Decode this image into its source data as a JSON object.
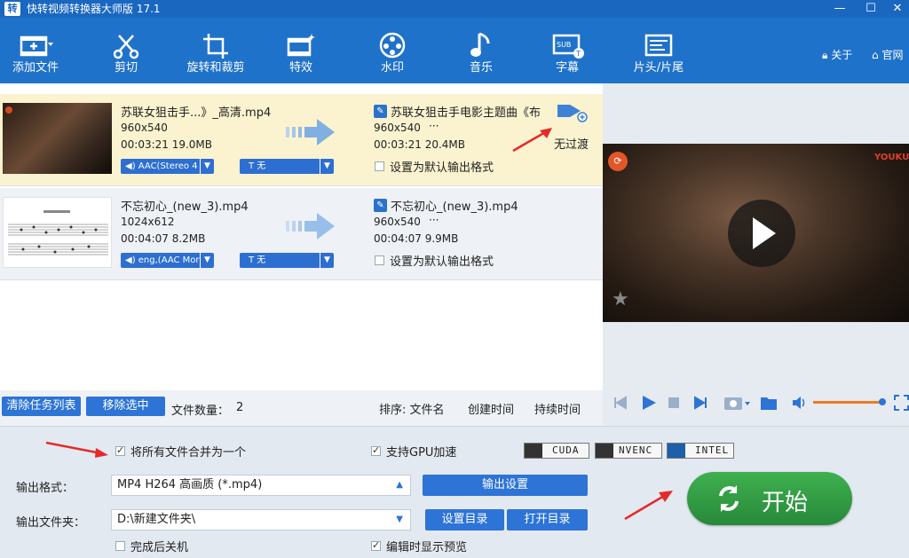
{
  "window": {
    "title": "快转视频转换器大师版 17.1",
    "logo_text": "转",
    "btn_min": "—",
    "btn_max": "☐",
    "btn_close": "✕"
  },
  "toolbar": {
    "items": [
      {
        "label": "添加文件",
        "icon": "film-add-icon"
      },
      {
        "label": "剪切",
        "icon": "scissors-icon"
      },
      {
        "label": "旋转和裁剪",
        "icon": "crop-rotate-icon"
      },
      {
        "label": "特效",
        "icon": "effects-film-icon"
      },
      {
        "label": "水印",
        "icon": "watermark-film-reel-icon"
      },
      {
        "label": "音乐",
        "icon": "music-note-icon"
      },
      {
        "label": "字幕",
        "icon": "subtitle-icon"
      },
      {
        "label": "片头/片尾",
        "icon": "intro-outro-icon"
      }
    ],
    "about": "关于",
    "website": "官网"
  },
  "tasks": [
    {
      "src_name": "苏联女狙击手...》_高清.mp4",
      "src_res": "960x540",
      "src_meta": "00:03:21  19.0MB",
      "out_name": "苏联女狙击手电影主题曲《布",
      "out_res": "960x540",
      "out_more": "···",
      "out_meta": "00:03:21  20.4MB",
      "audio": "AAC(Stereo 4",
      "subtitle": "T 无",
      "default_fmt": "设置为默认输出格式",
      "transition": "无过渡",
      "selected": true
    },
    {
      "src_name": "不忘初心_(new_3).mp4",
      "src_res": "1024x612",
      "src_meta": "00:04:07  8.2MB",
      "out_name": "不忘初心_(new_3).mp4",
      "out_res": "960x540",
      "out_more": "···",
      "out_meta": "00:04:07  9.9MB",
      "audio": "eng,(AAC Mor",
      "subtitle": "T 无",
      "default_fmt": "设置为默认输出格式",
      "selected": false
    }
  ],
  "list_footer": {
    "clear": "清除任务列表",
    "remove": "移除选中",
    "count_label": "文件数量：",
    "count": "2",
    "sort_label": "排序: 文件名",
    "sort_created": "创建时间",
    "sort_duration": "持续时间"
  },
  "preview": {
    "watermark": "YOUKU"
  },
  "settings": {
    "merge_label": "将所有文件合并为一个",
    "merge_checked": true,
    "gpu_label": "支持GPU加速",
    "gpu_checked": true,
    "gpu_badges": [
      "CUDA",
      "NVENC",
      "INTEL"
    ],
    "format_label": "输出格式：",
    "format_value": "MP4  H264 高画质 (*.mp4)",
    "output_settings": "输出设置",
    "folder_label": "输出文件夹：",
    "folder_value": "D:\\新建文件夹\\",
    "set_dir": "设置目录",
    "open_dir": "打开目录",
    "shutdown_label": "完成后关机",
    "shutdown_checked": false,
    "preview_label": "编辑时显示预览",
    "preview_checked": true,
    "start": "开始"
  },
  "colors": {
    "title_bar": "#1a67c0",
    "toolbar": "#1f72c9",
    "accent_blue": "#2d74d6",
    "start_green": "#2e9a3f",
    "selected_row": "#fbf3cf",
    "red_arrow": "#e52a2a"
  }
}
